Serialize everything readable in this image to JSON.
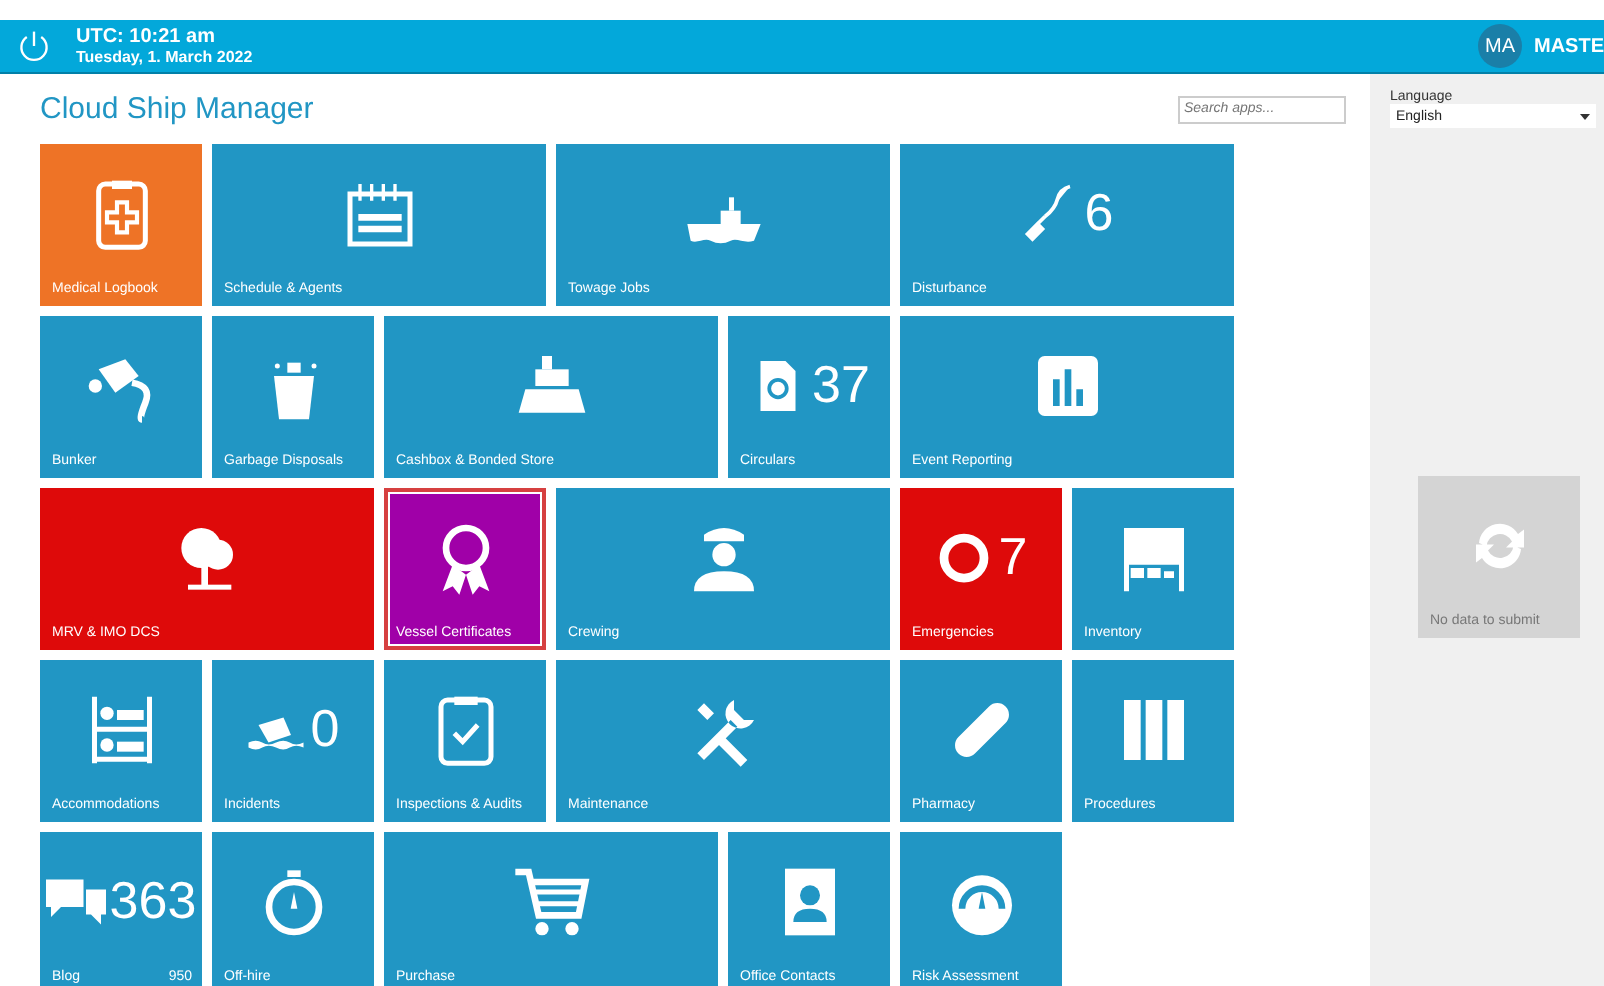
{
  "header": {
    "time": "UTC: 10:21 am",
    "date": "Tuesday, 1. March 2022",
    "avatar": "MA",
    "user": "MASTE"
  },
  "title": "Cloud Ship Manager",
  "search": {
    "placeholder": "Search apps..."
  },
  "tiles": [
    {
      "label": "Medical Logbook",
      "kind": "square",
      "color": "#ee7326",
      "selected": false
    },
    {
      "label": "Schedule & Agents",
      "kind": "wide",
      "color": "#2196c4",
      "selected": false
    },
    {
      "label": "Towage Jobs",
      "kind": "wide",
      "color": "#2196c4",
      "selected": false
    },
    {
      "label": "Disturbance",
      "kind": "wide",
      "color": "#2196c4",
      "selected": false,
      "count": "6"
    },
    {
      "label": "Bunker",
      "kind": "square",
      "color": "#2196c4",
      "selected": false
    },
    {
      "label": "Garbage Disposals",
      "kind": "square",
      "color": "#2196c4",
      "selected": false
    },
    {
      "label": "Cashbox & Bonded Store",
      "kind": "wide",
      "color": "#2196c4",
      "selected": false
    },
    {
      "label": "Circulars",
      "kind": "square",
      "color": "#2196c4",
      "selected": false,
      "count": "37"
    },
    {
      "label": "Event Reporting",
      "kind": "wide",
      "color": "#2196c4",
      "selected": false
    },
    {
      "label": "MRV & IMO DCS",
      "kind": "wide",
      "color": "#de0a0a",
      "selected": false
    },
    {
      "label": "Vessel Certificates",
      "kind": "square",
      "color": "#a000a8",
      "selected": true
    },
    {
      "label": "Crewing",
      "kind": "wide",
      "color": "#2196c4",
      "selected": false
    },
    {
      "label": "Emergencies",
      "kind": "square",
      "color": "#de0a0a",
      "selected": false,
      "count": "7"
    },
    {
      "label": "Inventory",
      "kind": "square",
      "color": "#2196c4",
      "selected": false
    },
    {
      "label": "Accommodations",
      "kind": "square",
      "color": "#2196c4",
      "selected": false
    },
    {
      "label": "Incidents",
      "kind": "square",
      "color": "#2196c4",
      "selected": false,
      "count": "0"
    },
    {
      "label": "Inspections & Audits",
      "kind": "square",
      "color": "#2196c4",
      "selected": false
    },
    {
      "label": "Maintenance",
      "kind": "wide",
      "color": "#2196c4",
      "selected": false
    },
    {
      "label": "Pharmacy",
      "kind": "square",
      "color": "#2196c4",
      "selected": false
    },
    {
      "label": "Procedures",
      "kind": "square",
      "color": "#2196c4",
      "selected": false
    },
    {
      "label": "Blog",
      "kind": "square",
      "color": "#2196c4",
      "selected": false,
      "count": "363",
      "secondary": "950"
    },
    {
      "label": "Off-hire",
      "kind": "square",
      "color": "#2196c4",
      "selected": false
    },
    {
      "label": "Purchase",
      "kind": "wide",
      "color": "#2196c4",
      "selected": false
    },
    {
      "label": "Office Contacts",
      "kind": "square",
      "color": "#2196c4",
      "selected": false
    },
    {
      "label": "Risk Assessment",
      "kind": "square",
      "color": "#2196c4",
      "selected": false
    }
  ],
  "sidebar": {
    "language_label": "Language",
    "language": "English",
    "submit": {
      "label": "No data to submit",
      "disabled": true
    }
  }
}
